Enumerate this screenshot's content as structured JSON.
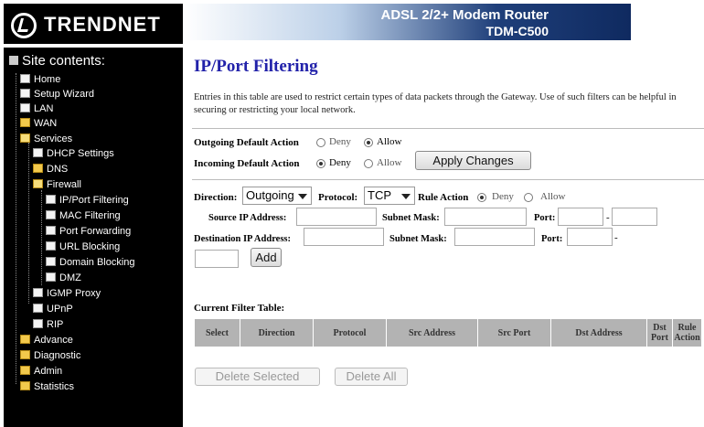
{
  "header": {
    "logo_text": "TRENDNET",
    "product_title": "ADSL 2/2+ Modem Router",
    "model": "TDM-C500"
  },
  "sidebar": {
    "title": "Site contents:",
    "items": [
      {
        "label": "Home",
        "icon": "page-icon"
      },
      {
        "label": "Setup Wizard",
        "icon": "page-icon"
      },
      {
        "label": "LAN",
        "icon": "page-icon"
      },
      {
        "label": "WAN",
        "icon": "folder-icon"
      },
      {
        "label": "Services",
        "icon": "folder-open-icon"
      },
      {
        "label": "DHCP Settings",
        "icon": "page-icon"
      },
      {
        "label": "DNS",
        "icon": "folder-icon"
      },
      {
        "label": "Firewall",
        "icon": "folder-open-icon"
      },
      {
        "label": "IP/Port Filtering",
        "icon": "page-icon"
      },
      {
        "label": "MAC Filtering",
        "icon": "page-icon"
      },
      {
        "label": "Port Forwarding",
        "icon": "page-icon"
      },
      {
        "label": "URL Blocking",
        "icon": "page-icon"
      },
      {
        "label": "Domain Blocking",
        "icon": "page-icon"
      },
      {
        "label": "DMZ",
        "icon": "page-icon"
      },
      {
        "label": "IGMP Proxy",
        "icon": "page-icon"
      },
      {
        "label": "UPnP",
        "icon": "page-icon"
      },
      {
        "label": "RIP",
        "icon": "page-icon"
      },
      {
        "label": "Advance",
        "icon": "folder-icon"
      },
      {
        "label": "Diagnostic",
        "icon": "folder-icon"
      },
      {
        "label": "Admin",
        "icon": "folder-icon"
      },
      {
        "label": "Statistics",
        "icon": "folder-icon"
      }
    ]
  },
  "main": {
    "title": "IP/Port Filtering",
    "description": "Entries in this table are used to restrict certain types of data packets through the Gateway. Use of such filters can be helpful in securing or restricting your local network.",
    "outgoing_label": "Outgoing Default Action",
    "incoming_label": "Incoming Default Action",
    "deny_label": "Deny",
    "allow_label": "Allow",
    "outgoing_selected": "Allow",
    "incoming_selected": "Deny",
    "apply_button": "Apply Changes",
    "direction_label": "Direction:",
    "direction_value": "Outgoing",
    "protocol_label": "Protocol:",
    "protocol_value": "TCP",
    "rule_action_label": "Rule Action",
    "rule_action_selected": "Deny",
    "src_ip_label": "Source IP Address:",
    "subnet_mask_label": "Subnet Mask:",
    "port_label": "Port:",
    "dst_ip_label": "Destination IP Address:",
    "dash": "-",
    "add_button": "Add",
    "table_title": "Current Filter Table:",
    "table_headers": [
      "Select",
      "Direction",
      "Protocol",
      "Src Address",
      "Src Port",
      "Dst Address",
      "Dst Port",
      "Rule Action"
    ],
    "delete_selected_button": "Delete Selected",
    "delete_all_button": "Delete All"
  },
  "colors": {
    "title_blue": "#2222aa",
    "table_header_gray": "#b3b3b3",
    "sidebar_bg": "#000000"
  }
}
